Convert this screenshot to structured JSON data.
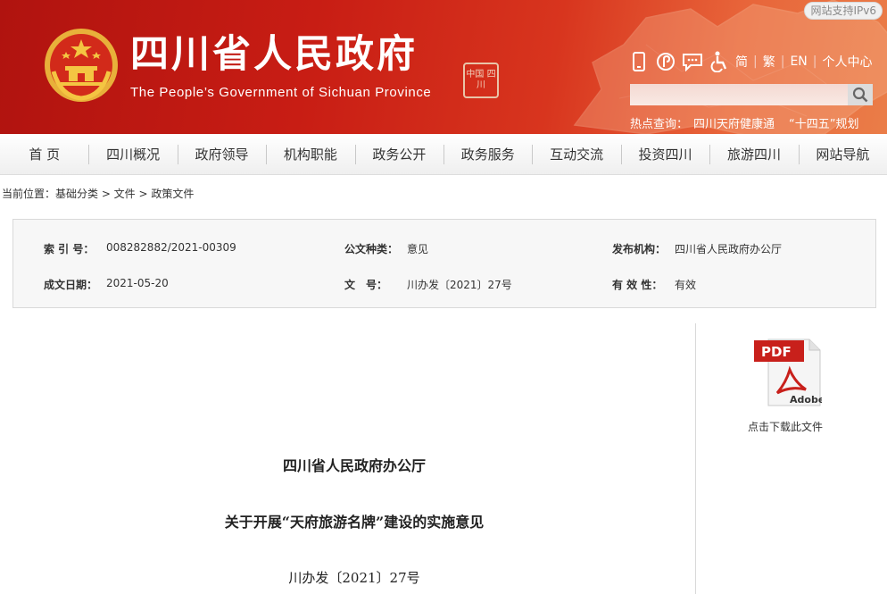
{
  "header": {
    "title": "四川省人民政府",
    "subtitle": "The People’s Government of Sichuan Province",
    "seal_text": "中国 四川",
    "ipv6_badge": "网站支持IPv6",
    "tools": {
      "simplified": "简",
      "traditional": "繁",
      "english": "EN",
      "user_center": "个人中心"
    },
    "search": {
      "placeholder": ""
    },
    "hot": {
      "label": "热点查询：",
      "items": [
        "四川天府健康通",
        "“十四五”规划"
      ]
    }
  },
  "nav": [
    "首 页",
    "四川概况",
    "政府领导",
    "机构职能",
    "政务公开",
    "政务服务",
    "互动交流",
    "投资四川",
    "旅游四川",
    "网站导航"
  ],
  "breadcrumb": "当前位置：基础分类 > 文件 > 政策文件",
  "meta": {
    "index_label": "索 引 号：",
    "index_value": "008282882/2021-00309",
    "type_label": "公文种类：",
    "type_value": "意见",
    "org_label": "发布机构：",
    "org_value": "四川省人民政府办公厅",
    "date_label": "成文日期：",
    "date_value": "2021-05-20",
    "docno_label": "文　号：",
    "docno_value": "川办发〔2021〕27号",
    "valid_label": "有 效 性：",
    "valid_value": "有效"
  },
  "sidebar": {
    "pdf_badge": "PDF",
    "pdf_brand": "Adobe",
    "download_label": "点击下载此文件"
  },
  "document": {
    "issuer": "四川省人民政府办公厅",
    "title": "关于开展“天府旅游名牌”建设的实施意见",
    "number": "川办发〔2021〕27号"
  },
  "colors": {
    "header_red": "#c81d14",
    "header_orange": "#ea7d48"
  }
}
